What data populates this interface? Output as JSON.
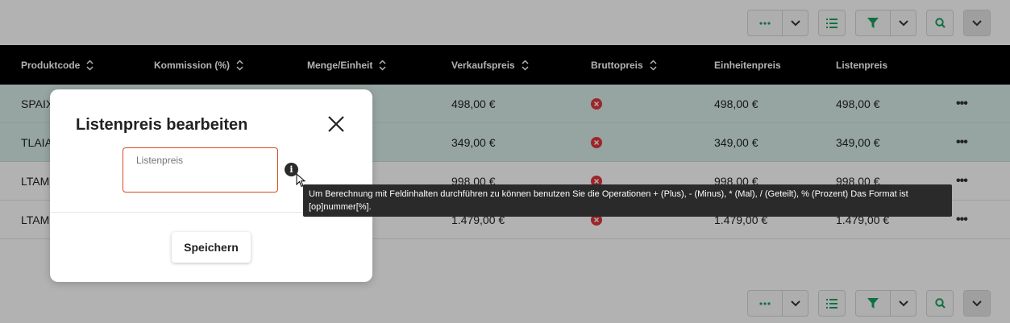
{
  "table": {
    "columns": [
      {
        "label": "Produktcode",
        "sortable": true
      },
      {
        "label": "Kommission (%)",
        "sortable": true
      },
      {
        "label": "Menge/Einheit",
        "sortable": true
      },
      {
        "label": "Verkaufspreis",
        "sortable": true
      },
      {
        "label": "Bruttopreis",
        "sortable": true
      },
      {
        "label": "Einheitenpreis",
        "sortable": false
      },
      {
        "label": "Listenpreis",
        "sortable": false
      }
    ],
    "rows": [
      {
        "code": "SPAIX",
        "verkaufspreis": "498,00 €",
        "einheitenpreis": "498,00 €",
        "listenpreis": "498,00 €",
        "highlight": true
      },
      {
        "code": "TLAIA",
        "verkaufspreis": "349,00 €",
        "einheitenpreis": "349,00 €",
        "listenpreis": "349,00 €",
        "highlight": true
      },
      {
        "code": "LTAM",
        "verkaufspreis": "998,00 €",
        "einheitenpreis": "998,00 €",
        "listenpreis": "998,00 €",
        "highlight": false
      },
      {
        "code": "LTAM",
        "verkaufspreis": "1.479,00 €",
        "einheitenpreis": "1.479,00 €",
        "listenpreis": "1.479,00 €",
        "highlight": false
      }
    ],
    "row_actions": "•••"
  },
  "toolbar": {
    "more_icon": "more-horizontal-icon",
    "list_icon": "list-icon",
    "filter_icon": "filter-icon",
    "search_icon": "search-icon"
  },
  "modal": {
    "title": "Listenpreis bearbeiten",
    "field_label": "Listenpreis",
    "field_value": "",
    "info_glyph": "i",
    "save_label": "Speichern"
  },
  "tooltip": {
    "text": "Um Berechnung mit Feldinhalten durchführen zu können benutzen Sie die Operationen + (Plus), - (Minus), * (Mal), / (Geteilt), % (Prozent) Das Format ist [op]nummer[%]."
  },
  "colors": {
    "accent": "#19a15f",
    "header_bg": "#000000",
    "row_highlight": "#d7ece9",
    "error": "#e0353b",
    "field_border": "#d24a1d"
  }
}
